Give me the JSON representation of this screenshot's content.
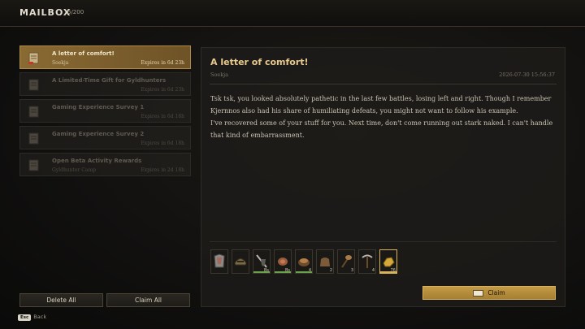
{
  "header": {
    "title": "MAILBOX",
    "count": "5/200"
  },
  "mails": [
    {
      "subject": "A letter of comfort!",
      "sender": "Soekja",
      "expires": "Expires in 6d 23h",
      "active": true
    },
    {
      "subject": "A Limited-Time Gift for Gyldhunters",
      "sender": "",
      "expires": "Expires in 6d 23h",
      "active": false
    },
    {
      "subject": "Gaming Experience Survey 1",
      "sender": "",
      "expires": "Expires in 6d 18h",
      "active": false
    },
    {
      "subject": "Gaming Experience Survey 2",
      "sender": "",
      "expires": "Expires in 6d 18h",
      "active": false
    },
    {
      "subject": "Open Beta Activity Rewards",
      "sender": "Gyldhunter Camp",
      "expires": "Expires in 2d 18h",
      "active": false
    }
  ],
  "buttons": {
    "delete_all": "Delete All",
    "claim_all": "Claim All",
    "back_key": "Esc",
    "back": "Back",
    "claim": "Claim"
  },
  "detail": {
    "title": "A letter of comfort!",
    "sender": "Soekja",
    "date": "2026-07-30 15:56:37",
    "body": [
      "Tsk tsk, you looked absolutely pathetic in the last few battles, losing left and right. Though I remember Kjernnos also had his share of humiliating defeats, you might not want to follow his example.",
      "I've recovered some of your stuff for you. Next time, don't come running out stark naked. I can't handle that kind of embarrassment."
    ]
  },
  "attachments": [
    {
      "icon": "armor-chest-icon",
      "qty": "",
      "bar": "none"
    },
    {
      "icon": "helmet-icon",
      "qty": "",
      "bar": "none"
    },
    {
      "icon": "shield-sword-icon",
      "qty": "Bs",
      "bar": "green"
    },
    {
      "icon": "meat-icon",
      "qty": "Bs",
      "bar": "green"
    },
    {
      "icon": "food-bowl-icon",
      "qty": "4",
      "bar": "green"
    },
    {
      "icon": "pouch-icon",
      "qty": "2",
      "bar": "none"
    },
    {
      "icon": "club-icon",
      "qty": "3",
      "bar": "none"
    },
    {
      "icon": "pickaxe-icon",
      "qty": "4",
      "bar": "none"
    },
    {
      "icon": "gold-ore-icon",
      "qty": "76",
      "bar": "gold"
    }
  ],
  "colors": {
    "accent": "#c49a45",
    "active_mail": "#8a6a33",
    "title_text": "#e6c98d"
  }
}
